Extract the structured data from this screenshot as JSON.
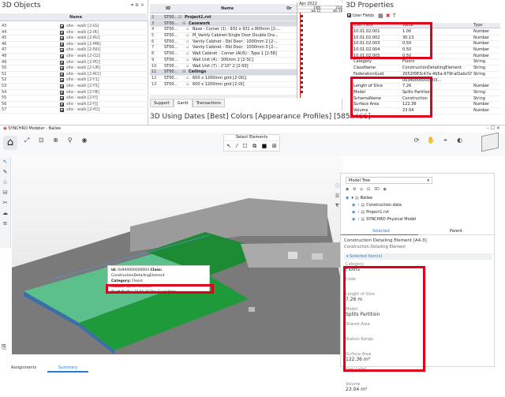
{
  "objects_panel": {
    "title": "3D Objects",
    "column_name": "Name",
    "rows": [
      {
        "n": "43",
        "name": "site - walk [2-IG]"
      },
      {
        "n": "44",
        "name": "site - walk [2-IR]"
      },
      {
        "n": "45",
        "name": "site - walk [2-KU]"
      },
      {
        "n": "46",
        "name": "site - walk [2-MB]"
      },
      {
        "n": "47",
        "name": "site - walk [2-NU]"
      },
      {
        "n": "48",
        "name": "site - walk [2-O2]"
      },
      {
        "n": "49",
        "name": "site - walk [2-PD]"
      },
      {
        "n": "50",
        "name": "site - walk [2-UR]"
      },
      {
        "n": "51",
        "name": "site - walk [2-W2]"
      },
      {
        "n": "52",
        "name": "site - walk [2-Y1]"
      },
      {
        "n": "53",
        "name": "site - walk [2-Y5]"
      },
      {
        "n": "54",
        "name": "site - walk [2-YB]"
      },
      {
        "n": "55",
        "name": "site - walk [2-YI]"
      },
      {
        "n": "56",
        "name": "site - walk [2-YJ]"
      },
      {
        "n": "57",
        "name": "site - walk [2-YO]"
      }
    ]
  },
  "gantt": {
    "col_id": "ID",
    "col_name": "Name",
    "col_extra": "Or",
    "date_header": "Apr 2022",
    "week1": "14th",
    "week2": "21st",
    "wk1": "wk 15",
    "wk2": "wk 16",
    "rows": [
      {
        "n": "1",
        "id": "ID",
        "name": "",
        "bold": false
      },
      {
        "n": "2",
        "id": "ST00...",
        "name": "Project1.rvt",
        "bold": true,
        "indent": 0
      },
      {
        "n": "3",
        "id": "ST00...",
        "name": "Casework",
        "bold": true,
        "indent": 1
      },
      {
        "n": "4",
        "id": "ST00...",
        "name": "Base - Corner (1) : 931 x 931 x 800mm [2-...",
        "bold": false,
        "indent": 2
      },
      {
        "n": "5",
        "id": "ST00...",
        "name": "M_Vanity Cabinet-Single Door Double Dra...",
        "bold": false,
        "indent": 2
      },
      {
        "n": "6",
        "id": "ST00...",
        "name": "Vanity Cabinet - Dbl Door : 1000mm 2 [2-...",
        "bold": false,
        "indent": 2
      },
      {
        "n": "7",
        "id": "ST00...",
        "name": "Vanity Cabinet - Dbl Door : 1000mm 3 [2-...",
        "bold": false,
        "indent": 2
      },
      {
        "n": "8",
        "id": "ST00...",
        "name": "Wall Cabinet - Corner (AUS) : Type 1 [2-58]",
        "bold": false,
        "indent": 2
      },
      {
        "n": "9",
        "id": "ST00...",
        "name": "Wall Unit (4) : 300mm 2 [2-SC]",
        "bold": false,
        "indent": 2
      },
      {
        "n": "10",
        "id": "ST00...",
        "name": "Wall Unit (7) : 2'10\" 2 [2-S5]",
        "bold": false,
        "indent": 2
      },
      {
        "n": "11",
        "id": "ST00...",
        "name": "Ceilings",
        "bold": true,
        "indent": 1
      },
      {
        "n": "12",
        "id": "ST00...",
        "name": "600 x 1200mm grid [2-OG]",
        "bold": false,
        "indent": 2
      },
      {
        "n": "13",
        "id": "ST00...",
        "name": "600 x 1200mm grid [2-OI]",
        "bold": false,
        "indent": 2
      }
    ],
    "tabs": [
      "Support",
      "Gantt",
      "Transactions"
    ]
  },
  "viewport_title": "3D Using Dates [Best] Colors [Appearance Profiles]  [585x466]",
  "properties": {
    "title": "3D Properties",
    "toolbar_label": "User Fields",
    "col_field": "User Field",
    "col_value": "Value",
    "col_type": "Type",
    "rows": [
      {
        "f": "10.01.02.001",
        "v": "1.00",
        "t": "Number"
      },
      {
        "f": "10.01.02.002",
        "v": "30.13",
        "t": "Number"
      },
      {
        "f": "10.01.02.003",
        "v": "0.50",
        "t": "Number"
      },
      {
        "f": "10.01.02.004",
        "v": "0.50",
        "t": "Number"
      },
      {
        "f": "10.01.02.005",
        "v": "0.50",
        "t": "Number"
      },
      {
        "f": "Category",
        "v": "Floors",
        "t": "String"
      },
      {
        "f": "ClassName",
        "v": "ConstructionDetailingElement",
        "t": "String"
      },
      {
        "f": "FederationGuid",
        "v": "2052f083c47a-4b5a-979f-af2abcf2957b",
        "t": "String"
      },
      {
        "f": "",
        "v": "0x340000000003...",
        "t": ""
      },
      {
        "f": "Length of Slice",
        "v": "7.26",
        "t": "Number"
      },
      {
        "f": "Model",
        "v": "Splits Partition",
        "t": "String"
      },
      {
        "f": "SchemaName",
        "v": "Construction",
        "t": "String"
      },
      {
        "f": "Surface Area",
        "v": "122.36",
        "t": "Number"
      },
      {
        "f": "Volume",
        "v": "23.04",
        "t": "Number"
      }
    ]
  },
  "modeler": {
    "title": "SYNCHRO Modeler - Bailee",
    "select_elements": "Select Elements",
    "tabs": [
      "Assignments",
      "Summary"
    ],
    "tooltip": {
      "id_label": "Id:",
      "id": "0x940000000003",
      "class_label": "Class:",
      "class": "ConstructionDetailingElement",
      "category_label": "Category:",
      "category": "Floors",
      "model_label": "Model:",
      "model": "Splits Partition",
      "cost_label": "Cost Code:",
      "cost": "10.01.02 Pre-Cast Walls"
    },
    "model_tree": {
      "dropdown": "Model Tree",
      "view_label": "3D",
      "items": [
        "Bailee",
        "Construction data",
        "Project1.rvt",
        "SYNCHRO Physical Model"
      ]
    },
    "detail": {
      "tab_selected": "Selected",
      "tab_parent": "Parent",
      "element_title": "Construction Detailing Element [A4-3]",
      "element_sub": "Construction Detailing Element",
      "section": "Selected Item(s)",
      "fields": [
        {
          "k": "Category",
          "v": "Floors"
        },
        {
          "k": "Code",
          "v": ""
        },
        {
          "k": "Length of Slice",
          "v": "7.26 m"
        },
        {
          "k": "Model",
          "v": "Splits Partition"
        },
        {
          "k": "Shared Area",
          "v": ""
        },
        {
          "k": "Station Range",
          "v": ""
        },
        {
          "k": "Surface Area",
          "v": "122.36 m²"
        },
        {
          "k": "User Label",
          "v": ""
        },
        {
          "k": "Volume",
          "v": "23.04 m³"
        }
      ]
    }
  }
}
